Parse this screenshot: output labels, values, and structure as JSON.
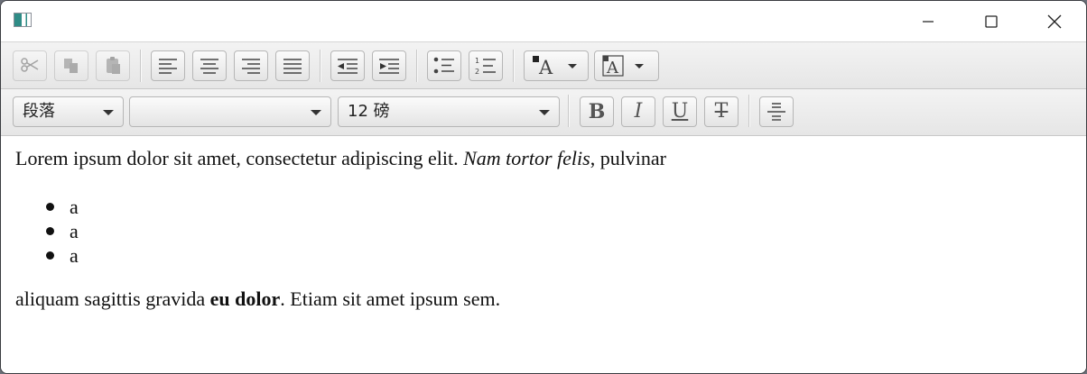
{
  "window": {
    "title": ""
  },
  "format_bar": {
    "paragraph_style": "段落",
    "font_family": "",
    "font_size": "12 磅",
    "bold_label": "B",
    "italic_label": "I",
    "underline_label": "U",
    "strike_label": "T"
  },
  "toolbar_icons": [
    "cut-icon",
    "copy-icon",
    "paste-icon",
    "align-left-icon",
    "align-center-icon",
    "align-right-icon",
    "align-justify-icon",
    "outdent-icon",
    "indent-icon",
    "bullet-list-icon",
    "numbered-list-icon",
    "text-color-icon",
    "background-color-icon",
    "horizontal-rule-icon"
  ],
  "content": {
    "p1": {
      "text1": "Lorem ipsum dolor sit amet, consectetur adipiscing elit. ",
      "italic": "Nam tortor felis",
      "text2": ", pulvinar"
    },
    "bullets": [
      "a",
      "a",
      "a"
    ],
    "p2": {
      "text1": "aliquam sagittis gravida ",
      "bold": "eu dolor",
      "text2": ". Etiam sit amet ipsum sem."
    }
  },
  "colors": {
    "toolbar_bg": "#e9e9e9",
    "button_border": "#b6b6b6",
    "text": "#111111"
  }
}
